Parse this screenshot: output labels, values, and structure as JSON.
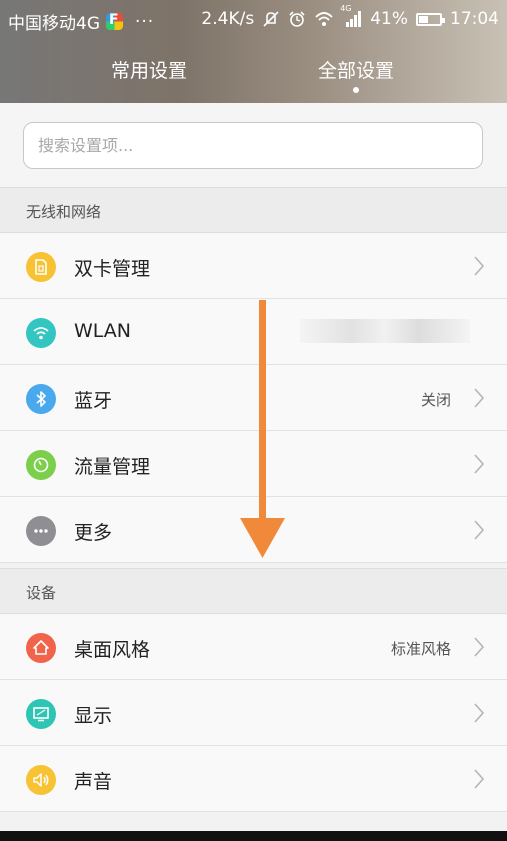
{
  "status_bar": {
    "carrier": "中国移动4G",
    "dots": "···",
    "speed": "2.4K/s",
    "network": "4G",
    "battery": "41%",
    "time": "17:04"
  },
  "tabs": [
    {
      "label": "常用设置",
      "active": false
    },
    {
      "label": "全部设置",
      "active": true
    }
  ],
  "search": {
    "placeholder": "搜索设置项..."
  },
  "sections": [
    {
      "header": "无线和网络",
      "items": [
        {
          "label": "双卡管理",
          "value": "",
          "icon": "sim-card-icon",
          "color": "#f7c234"
        },
        {
          "label": "WLAN",
          "value": "",
          "icon": "wifi-icon",
          "color": "#33c6c0"
        },
        {
          "label": "蓝牙",
          "value": "关闭",
          "icon": "bluetooth-icon",
          "color": "#4aa8ec"
        },
        {
          "label": "流量管理",
          "value": "",
          "icon": "data-usage-icon",
          "color": "#7ccf4a"
        },
        {
          "label": "更多",
          "value": "",
          "icon": "more-icon",
          "color": "#8e8e93"
        }
      ]
    },
    {
      "header": "设备",
      "items": [
        {
          "label": "桌面风格",
          "value": "标准风格",
          "icon": "home-icon",
          "color": "#f0644b"
        },
        {
          "label": "显示",
          "value": "",
          "icon": "display-icon",
          "color": "#2fc5b4"
        },
        {
          "label": "声音",
          "value": "",
          "icon": "sound-icon",
          "color": "#f7c234"
        }
      ]
    }
  ],
  "colors": {
    "arrow": "#f08a3a"
  }
}
